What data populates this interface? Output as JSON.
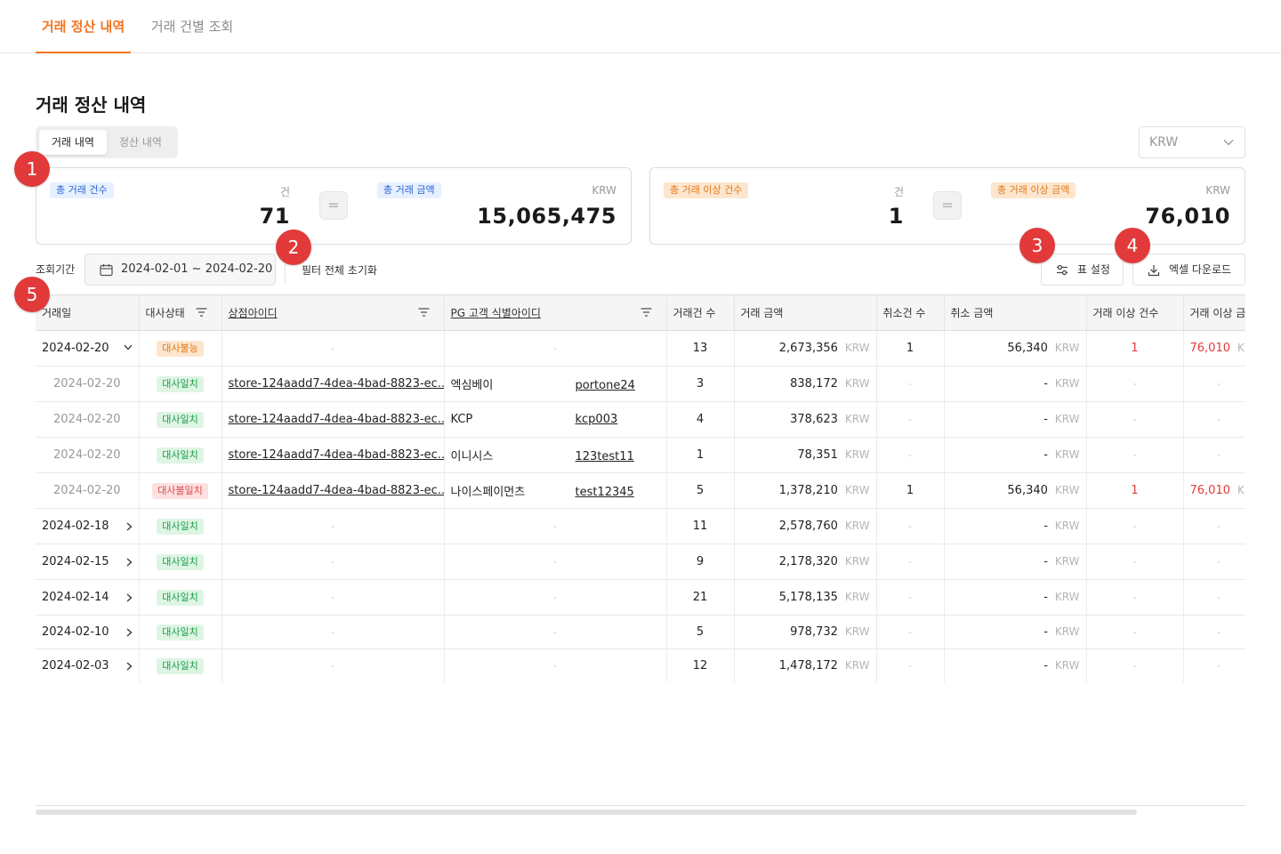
{
  "tabs": [
    "거래 정산 내역",
    "거래 건별 조회"
  ],
  "page_title": "거래 정산 내역",
  "segment": [
    "거래 내역",
    "정산 내역"
  ],
  "currency_select": "KRW",
  "summary_left": {
    "count_label": "총 거래 건수",
    "count_unit": "건",
    "count_value": "71",
    "equals": "=",
    "amount_label": "총 거래 금액",
    "amount_unit": "KRW",
    "amount_value": "15,065,475"
  },
  "summary_right": {
    "count_label": "총 거래 이상 건수",
    "count_unit": "건",
    "count_value": "1",
    "equals": "=",
    "amount_label": "총 거래 이상 금액",
    "amount_unit": "KRW",
    "amount_value": "76,010"
  },
  "markers": [
    "1",
    "2",
    "3",
    "4",
    "5"
  ],
  "filters": {
    "period_label": "조회기간",
    "date_range": "2024-02-01 ~ 2024-02-20",
    "reset_label": "필터 전체 초기화",
    "table_settings_label": "표 설정",
    "excel_download_label": "엑셀 다운로드"
  },
  "table": {
    "headers": [
      "거래일",
      "대사상태",
      "상점아이디",
      "PG 고객 식별아이디",
      "거래건 수",
      "거래 금액",
      "취소건 수",
      "취소 금액",
      "거래 이상 건수",
      "거래 이상 금"
    ],
    "currency_unit": "KRW",
    "dash": "-",
    "rows": [
      {
        "date": "2024-02-20",
        "status": "대사불능",
        "store": "-",
        "pg_name": "",
        "pg_id": "-",
        "count": "13",
        "amount": "2,673,356",
        "cancel_count": "1",
        "cancel_amount": "56,340",
        "anomaly_count": "1",
        "anomaly_amount": "76,010"
      },
      {
        "date": "2024-02-20",
        "status": "대사일치",
        "store": "store-124aadd7-4dea-4bad-8823-ec...",
        "pg_name": "엑심베이",
        "pg_id": "portone24",
        "count": "3",
        "amount": "838,172",
        "cancel_count": "-",
        "cancel_amount": "-",
        "anomaly_count": "-",
        "anomaly_amount": "-"
      },
      {
        "date": "2024-02-20",
        "status": "대사일치",
        "store": "store-124aadd7-4dea-4bad-8823-ec...",
        "pg_name": "KCP",
        "pg_id": "kcp003",
        "count": "4",
        "amount": "378,623",
        "cancel_count": "-",
        "cancel_amount": "-",
        "anomaly_count": "-",
        "anomaly_amount": "-"
      },
      {
        "date": "2024-02-20",
        "status": "대사일치",
        "store": "store-124aadd7-4dea-4bad-8823-ec...",
        "pg_name": "이니시스",
        "pg_id": "123test11",
        "count": "1",
        "amount": "78,351",
        "cancel_count": "-",
        "cancel_amount": "-",
        "anomaly_count": "-",
        "anomaly_amount": "-"
      },
      {
        "date": "2024-02-20",
        "status": "대사불일치",
        "store": "store-124aadd7-4dea-4bad-8823-ec...",
        "pg_name": "나이스페이먼츠",
        "pg_id": "test12345",
        "count": "5",
        "amount": "1,378,210",
        "cancel_count": "1",
        "cancel_amount": "56,340",
        "anomaly_count": "1",
        "anomaly_amount": "76,010"
      },
      {
        "date": "2024-02-18",
        "status": "대사일치",
        "store": "-",
        "pg_name": "",
        "pg_id": "-",
        "count": "11",
        "amount": "2,578,760",
        "cancel_count": "-",
        "cancel_amount": "-",
        "anomaly_count": "-",
        "anomaly_amount": "-"
      },
      {
        "date": "2024-02-15",
        "status": "대사일치",
        "store": "-",
        "pg_name": "",
        "pg_id": "-",
        "count": "9",
        "amount": "2,178,320",
        "cancel_count": "-",
        "cancel_amount": "-",
        "anomaly_count": "-",
        "anomaly_amount": "-"
      },
      {
        "date": "2024-02-14",
        "status": "대사일치",
        "store": "-",
        "pg_name": "",
        "pg_id": "-",
        "count": "21",
        "amount": "5,178,135",
        "cancel_count": "-",
        "cancel_amount": "-",
        "anomaly_count": "-",
        "anomaly_amount": "-"
      },
      {
        "date": "2024-02-10",
        "status": "대사일치",
        "store": "-",
        "pg_name": "",
        "pg_id": "-",
        "count": "5",
        "amount": "978,732",
        "cancel_count": "-",
        "cancel_amount": "-",
        "anomaly_count": "-",
        "anomaly_amount": "-"
      },
      {
        "date": "2024-02-03",
        "status": "대사일치",
        "store": "-",
        "pg_name": "",
        "pg_id": "-",
        "count": "12",
        "amount": "1,478,172",
        "cancel_count": "-",
        "cancel_amount": "-",
        "anomaly_count": "-",
        "anomaly_amount": "-"
      }
    ]
  },
  "colors": {
    "accent": "#f47421",
    "marker": "#e23a3a",
    "match": "#18a04a",
    "mismatch": "#e04a4a",
    "unreconcilable": "#e0781a"
  }
}
